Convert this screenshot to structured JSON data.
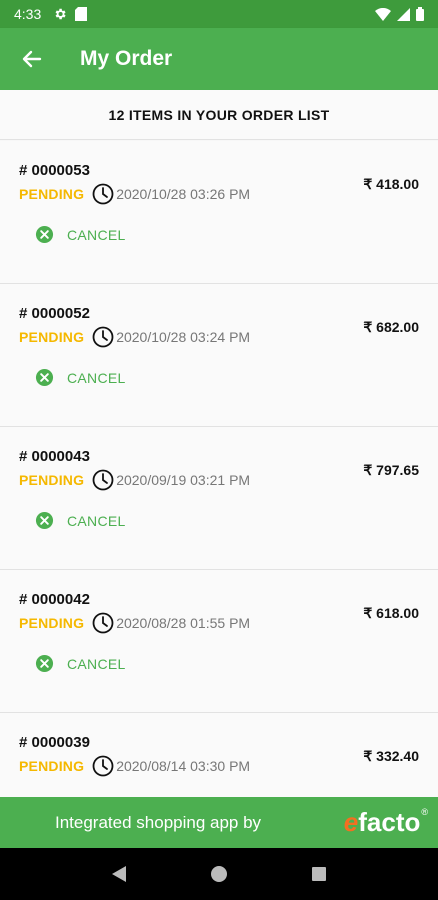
{
  "status_bar": {
    "time": "4:33"
  },
  "app_bar": {
    "title": "My Order"
  },
  "list_header": "12 ITEMS IN YOUR ORDER LIST",
  "orders": [
    {
      "id": "# 0000053",
      "status": "PENDING",
      "datetime": "2020/10/28 03:26 PM",
      "price": "₹ 418.00",
      "action": "CANCEL"
    },
    {
      "id": "# 0000052",
      "status": "PENDING",
      "datetime": "2020/10/28 03:24 PM",
      "price": "₹ 682.00",
      "action": "CANCEL"
    },
    {
      "id": "# 0000043",
      "status": "PENDING",
      "datetime": "2020/09/19 03:21 PM",
      "price": "₹ 797.65",
      "action": "CANCEL"
    },
    {
      "id": "# 0000042",
      "status": "PENDING",
      "datetime": "2020/08/28 01:55 PM",
      "price": "₹ 618.00",
      "action": "CANCEL"
    },
    {
      "id": "# 0000039",
      "status": "PENDING",
      "datetime": "2020/08/14 03:30 PM",
      "price": "₹ 332.40",
      "action": ""
    }
  ],
  "footer": {
    "text": "Integrated shopping app by",
    "logo_e": "e",
    "logo_rest": "facto",
    "logo_reg": "®"
  },
  "colors": {
    "primary": "#4caf50",
    "status_bar": "#3e9b3c",
    "pending": "#f5b800",
    "logo_accent": "#f36f21"
  }
}
